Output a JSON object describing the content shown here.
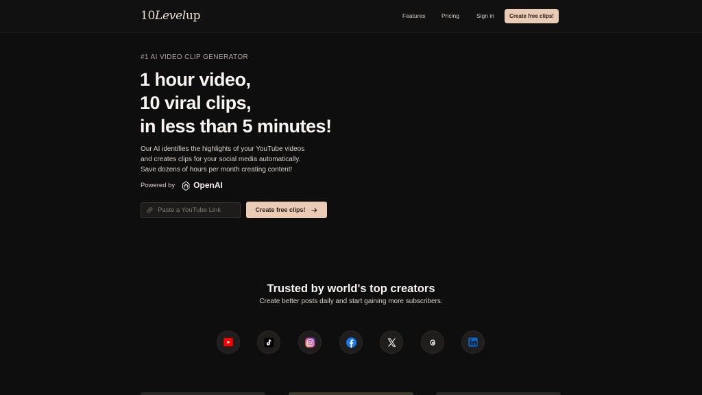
{
  "header": {
    "logo_prefix": "10",
    "logo_level": "Level",
    "logo_suffix": "up",
    "nav": {
      "features": "Features",
      "pricing": "Pricing",
      "sign_in": "Sign in"
    },
    "cta_label": "Create free clips!"
  },
  "hero": {
    "eyebrow": "#1 AI VIDEO CLIP GENERATOR",
    "headline": [
      "1 hour video,",
      "10 viral clips,",
      "in less than 5 minutes!"
    ],
    "description": [
      "Our AI identifies the highlights of your YouTube videos",
      "and creates clips for your social media automatically.",
      "Save dozens of hours per month creating content!"
    ],
    "powered_by": "Powered by",
    "powered_brand": "OpenAI",
    "url_placeholder": "Paste a YouTube Link",
    "url_value": "",
    "cta_label": "Create free clips!"
  },
  "trusted": {
    "title": "Trusted by world's top creators",
    "subtitle": "Create better posts daily and start gaining more subscribers."
  },
  "social_icons": [
    "youtube-icon",
    "tiktok-icon",
    "instagram-icon",
    "facebook-icon",
    "x-icon",
    "threads-icon",
    "linkedin-icon"
  ],
  "colors": {
    "background": "#0f0e0e",
    "accent": "#e9cbb6",
    "accent_text": "#2a1d16"
  }
}
